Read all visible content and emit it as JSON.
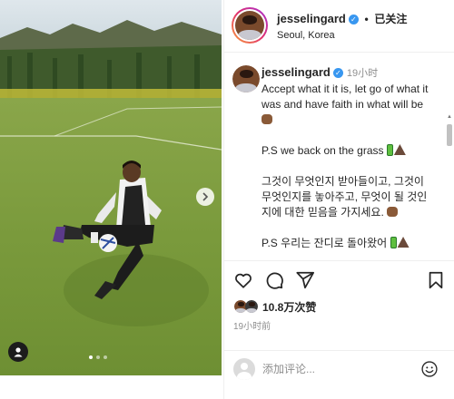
{
  "post": {
    "username": "jesselingard",
    "verified_glyph": "✓",
    "separator": "•",
    "follow_status": "已关注",
    "location": "Seoul, Korea",
    "icons": {
      "verified": "verified-badge-icon",
      "next": "chevron-right-icon",
      "tags": "user-tag-icon"
    },
    "carousel": {
      "total": 3,
      "active": 1
    }
  },
  "caption": {
    "username": "jesselingard",
    "time": "19小时",
    "line1a": "Accept what it it is, let go of what it",
    "line1b": "was and have faith in what will be",
    "line2": "P.S we back on the grass",
    "line3a": "그것이 무엇인지 받아들이고, 그것이",
    "line3b": "무엇인지를 놓아주고, 무엇이 될 것인",
    "line3c": "지에 대한 믿음을 가지세요.",
    "line4": "P.S 우리는 잔디로 돌아왔어"
  },
  "actions": {
    "icons": [
      "heart-icon",
      "comment-icon",
      "share-icon",
      "bookmark-icon"
    ]
  },
  "likes": {
    "count_text": "10.8万次赞",
    "time": "19小时前"
  },
  "comment": {
    "placeholder": "添加评论...",
    "emoji_icon": "smiley-icon"
  },
  "colors": {
    "accent": "#3897f0",
    "text": "#262626",
    "muted": "#8e8e8e",
    "border": "#efefef"
  }
}
